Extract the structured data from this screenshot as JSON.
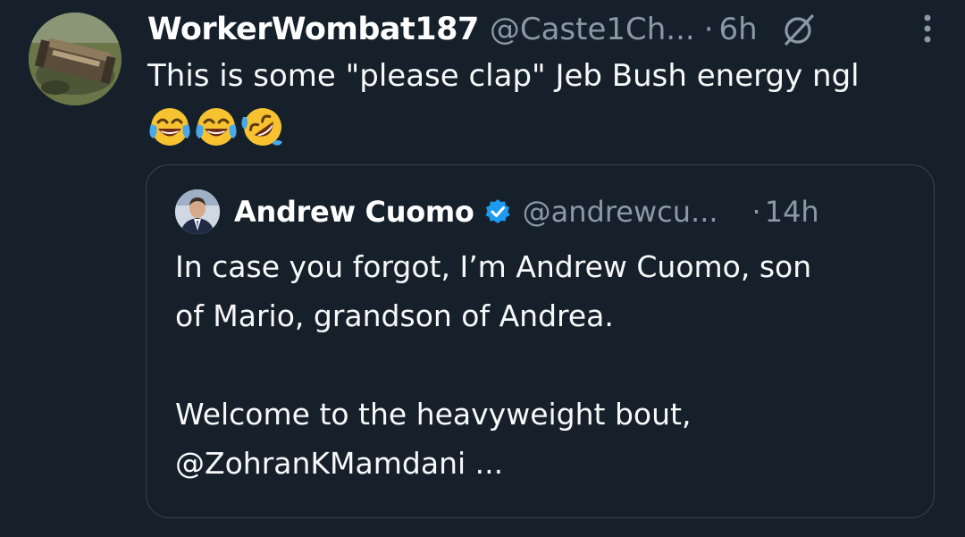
{
  "tweet": {
    "display_name": "WorkerWombat187",
    "handle": "@Caste1Ch...",
    "separator": "·",
    "time": "6h",
    "text": "This is some \"please clap\" Jeb Bush energy ngl",
    "emojis": [
      "face-with-tears-of-joy",
      "face-with-tears-of-joy",
      "rolling-on-the-floor-laughing"
    ],
    "icons": {
      "grok": "grok-icon",
      "more": "more-options-icon"
    }
  },
  "quoted_tweet": {
    "display_name": "Andrew Cuomo",
    "verified": true,
    "handle": "@andrewcu...",
    "separator": "·",
    "time": "14h",
    "text_line_1": "In case you forgot, I’m Andrew Cuomo, son",
    "text_line_2": "of Mario, grandson of Andrea.",
    "text_line_3": "Welcome to the heavyweight bout,",
    "text_line_4": "@ZohranKMamdani ..."
  },
  "colors": {
    "background": "#15202b",
    "secondary_text": "#8b98a5",
    "border": "#38444d",
    "verified_blue": "#1d9bf0"
  }
}
